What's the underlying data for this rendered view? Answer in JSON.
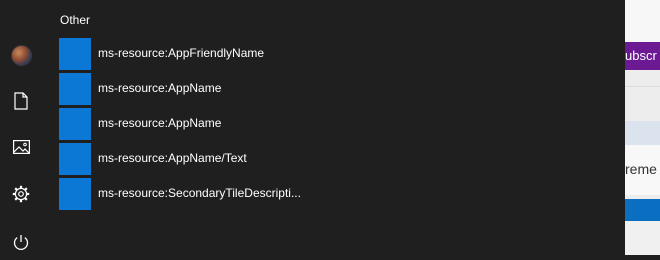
{
  "start_menu": {
    "group_header": "Other",
    "items": [
      {
        "label": "ms-resource:AppFriendlyName"
      },
      {
        "label": "ms-resource:AppName"
      },
      {
        "label": "ms-resource:AppName"
      },
      {
        "label": "ms-resource:AppName/Text"
      },
      {
        "label": "ms-resource:SecondaryTileDescripti..."
      }
    ],
    "tile_color": "#0a78d4"
  },
  "rail": {
    "icons": [
      "user-avatar",
      "document-icon",
      "pictures-icon",
      "settings-icon",
      "power-icon"
    ]
  },
  "background_app": {
    "button_text": "ubscr",
    "text_fragment": "reme",
    "accent_color": "#6c1a94",
    "blue_bar_color": "#0a6fc1"
  }
}
